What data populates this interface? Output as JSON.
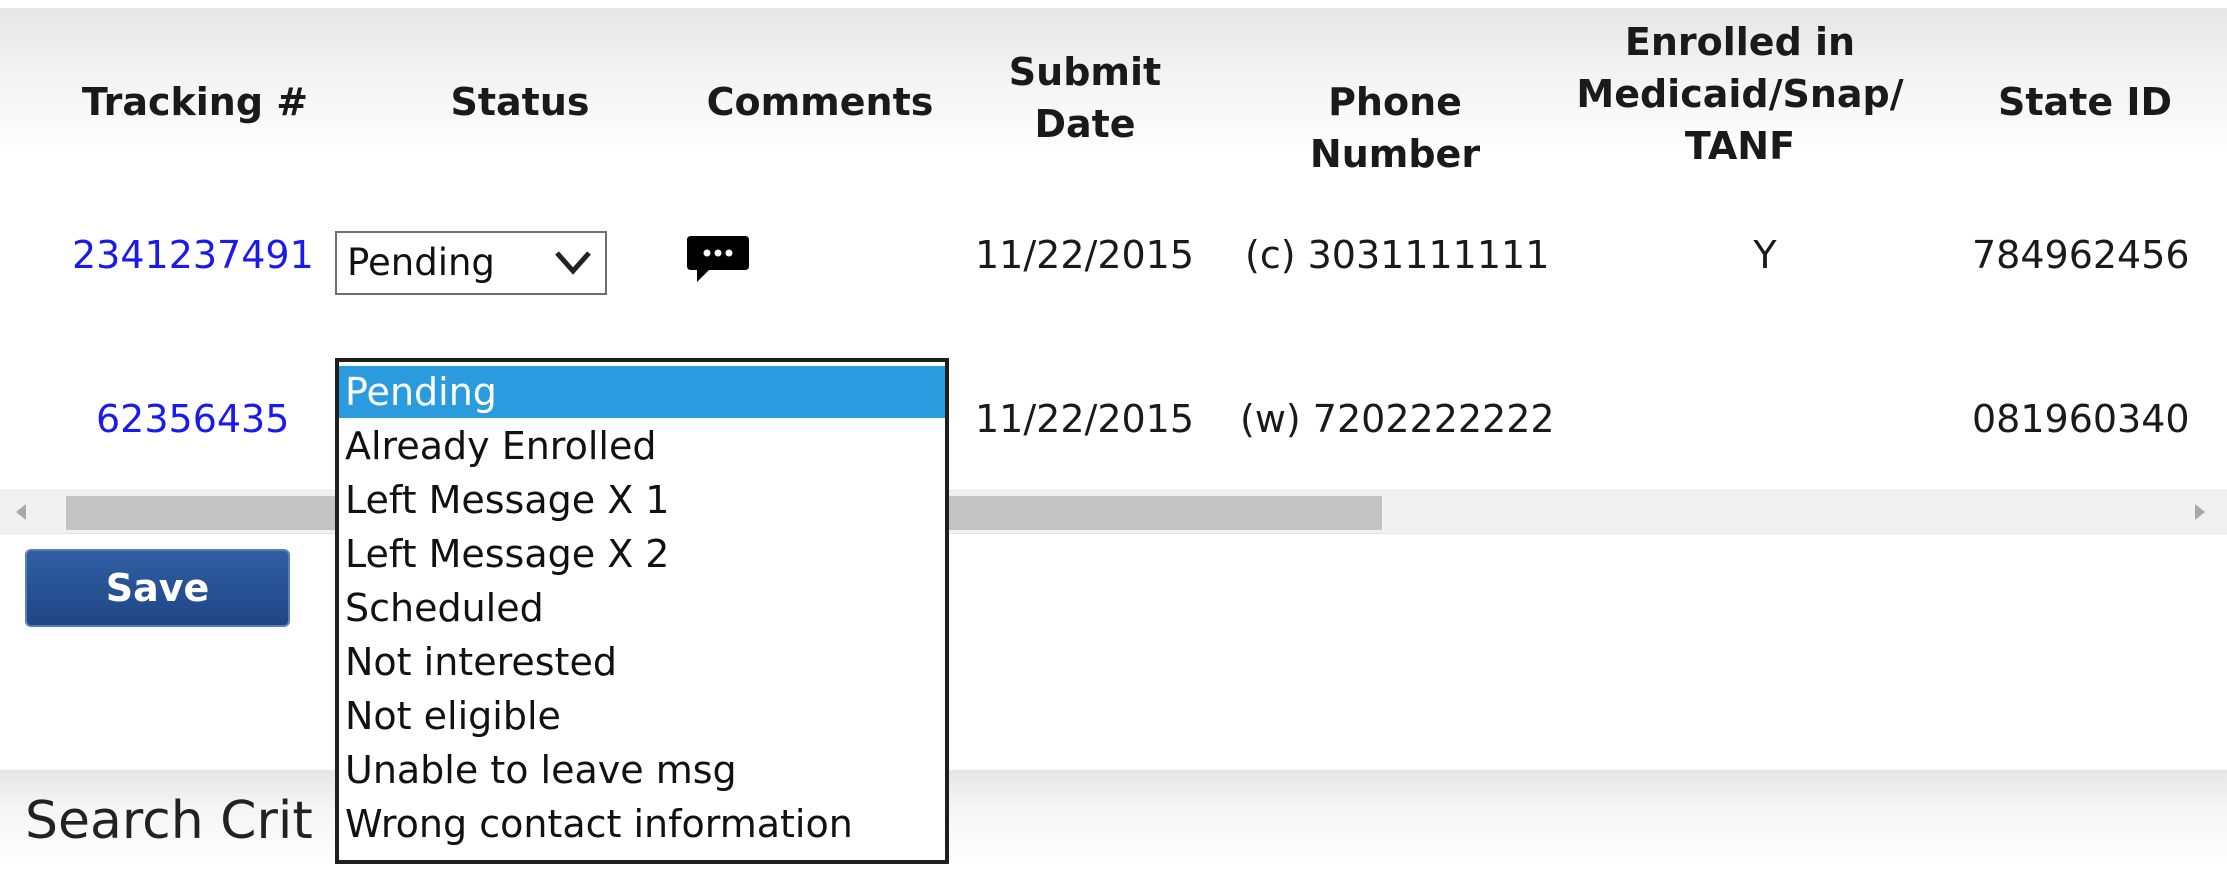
{
  "table": {
    "headers": {
      "tracking": "Tracking #",
      "status": "Status",
      "comments": "Comments",
      "submit_date": "Submit\nDate",
      "phone": "Phone Number",
      "enrolled": "Enrolled in\nMedicaid/Snap/\nTANF",
      "state_id": "State ID"
    },
    "rows": [
      {
        "tracking": "2341237491",
        "status": "Pending",
        "submit_date": "11/22/2015",
        "phone": "(c) 3031111111",
        "enrolled": "Y",
        "state_id": "784962456"
      },
      {
        "tracking": "62356435",
        "submit_date": "11/22/2015",
        "phone": "(w) 7202222222",
        "enrolled": "",
        "state_id": "081960340"
      }
    ]
  },
  "status_dropdown": {
    "selected": "Pending",
    "options": [
      "Pending",
      "Already Enrolled",
      "Left Message X 1",
      "Left Message X 2",
      "Scheduled",
      "Not interested",
      "Not eligible",
      "Unable to leave msg",
      "Wrong contact information"
    ]
  },
  "save_button": {
    "label": "Save"
  },
  "search_section": {
    "title": "Search Crit"
  },
  "icons": {
    "comment": "comment-bubble-icon",
    "chevron": "chevron-down-icon",
    "scroll_left": "scroll-left-arrow-icon",
    "scroll_right": "scroll-right-arrow-icon"
  },
  "colors": {
    "link": "#1a1aee",
    "highlight": "#2b9be0",
    "button": "#1e4686"
  }
}
